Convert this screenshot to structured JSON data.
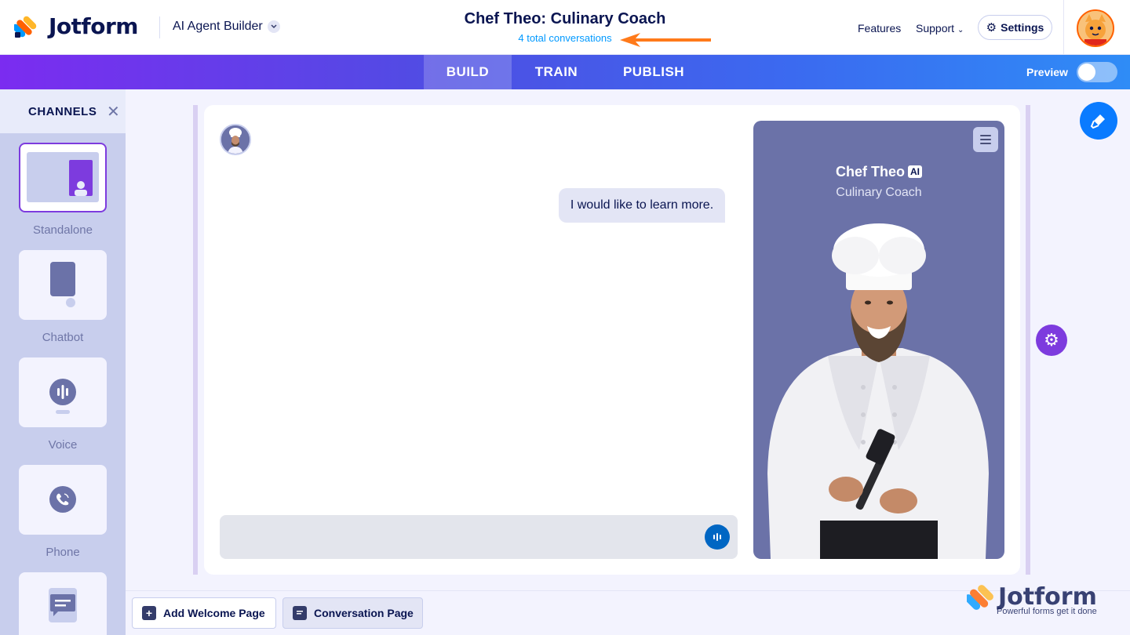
{
  "header": {
    "brand": "Jotform",
    "product": "AI Agent Builder",
    "agent_title": "Chef Theo: Culinary Coach",
    "conversations": "4 total conversations",
    "links": {
      "features": "Features",
      "support": "Support"
    },
    "settings_label": "Settings"
  },
  "tabs": [
    {
      "label": "BUILD",
      "active": true
    },
    {
      "label": "TRAIN",
      "active": false
    },
    {
      "label": "PUBLISH",
      "active": false
    }
  ],
  "preview": {
    "label": "Preview",
    "enabled": false
  },
  "sidebar": {
    "title": "CHANNELS",
    "channels": [
      {
        "label": "Standalone",
        "icon": "standalone-icon",
        "selected": true
      },
      {
        "label": "Chatbot",
        "icon": "chatbot-icon",
        "selected": false
      },
      {
        "label": "Voice",
        "icon": "voice-icon",
        "selected": false
      },
      {
        "label": "Phone",
        "icon": "phone-icon",
        "selected": false
      },
      {
        "label": "",
        "icon": "message-icon",
        "selected": false
      }
    ]
  },
  "chat": {
    "user_message": "I would like to learn more.",
    "input_placeholder": ""
  },
  "agent": {
    "name": "Chef Theo",
    "badge": "AI",
    "role": "Culinary Coach"
  },
  "pages": [
    {
      "label": "Add Welcome Page",
      "active": false
    },
    {
      "label": "Conversation Page",
      "active": true
    }
  ],
  "watermark": {
    "brand": "Jotform",
    "tagline": "Powerful forms get it done"
  },
  "colors": {
    "navy": "#0a1551",
    "accent_purple": "#7d3bde",
    "accent_blue": "#0a7bff",
    "link_blue": "#0099ff",
    "annotation_arrow": "#ff7a1a",
    "agent_panel": "#6b72a8"
  }
}
